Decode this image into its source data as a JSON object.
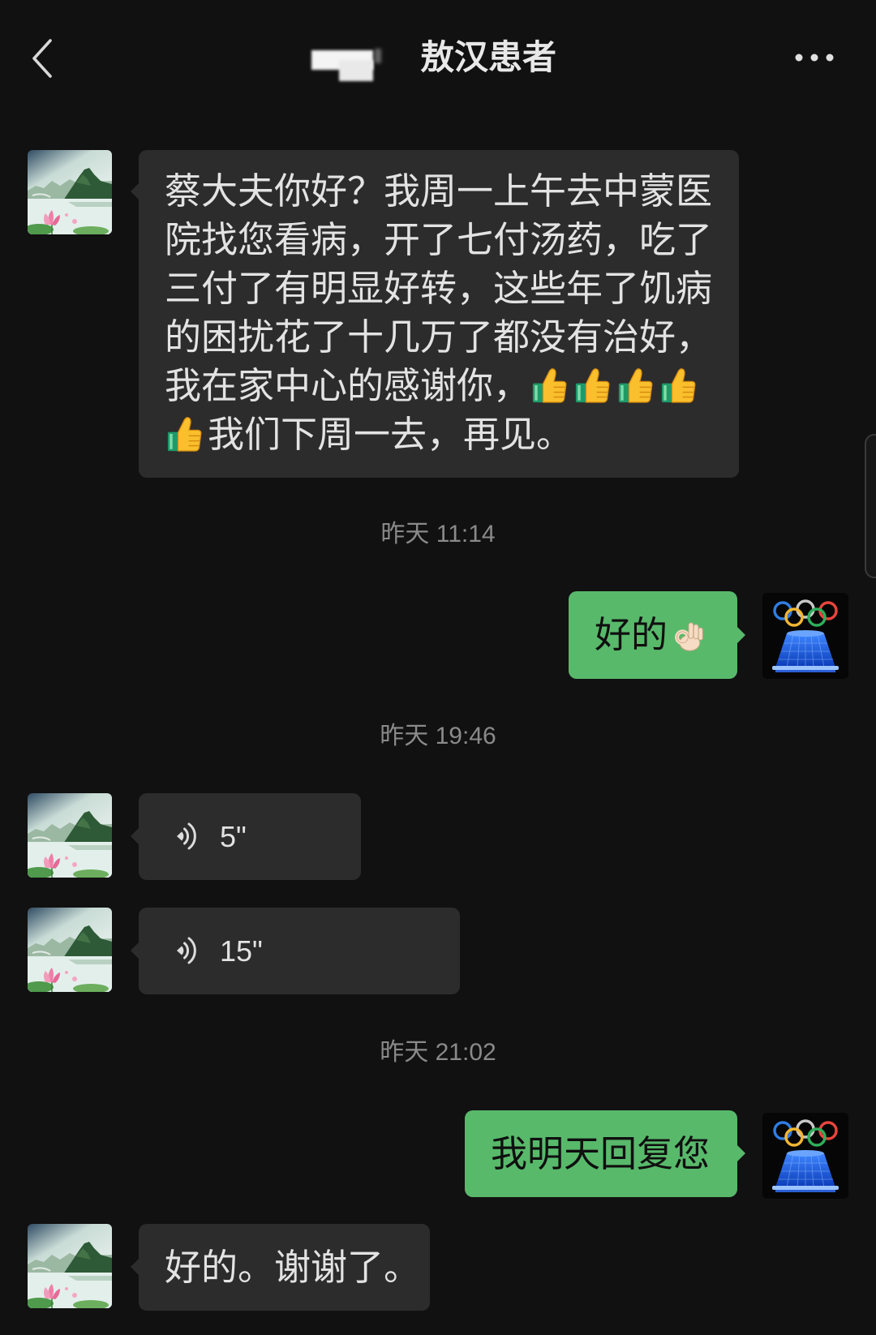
{
  "header": {
    "title": "敖汉患者",
    "back_icon": "chevron-left-icon",
    "more_icon": "more-dots-icon"
  },
  "colors": {
    "background": "#111111",
    "incoming_bubble": "#2c2c2c",
    "outgoing_bubble": "#58b96b",
    "timestamp_text": "#8a8a8a"
  },
  "messages": [
    {
      "incoming": {
        "lines": [
          "蔡大夫你好？我周一上午去中蒙医",
          "院找您看病，开了七付汤药，吃了",
          "三付了有明显好转，这些年了饥病",
          "的困扰花了十几万了都没有治好，",
          "我在家中心的感谢你，",
          "我们下周一去，再见。"
        ],
        "emoji_icon": "thumbs-up-icon",
        "emoji_count": 5
      }
    },
    {
      "timestamp": "昨天 11:14"
    },
    {
      "outgoing": {
        "text": "好的",
        "emoji_icon": "ok-hand-icon"
      }
    },
    {
      "timestamp": "昨天 19:46"
    },
    {
      "incoming_voice": {
        "duration": "5\"",
        "icon": "voice-wave-icon"
      }
    },
    {
      "incoming_voice": {
        "duration": "15\"",
        "icon": "voice-wave-icon"
      }
    },
    {
      "timestamp": "昨天 21:02"
    },
    {
      "outgoing": {
        "text": "我明天回复您"
      }
    },
    {
      "incoming": {
        "text": "好的。谢谢了。"
      }
    }
  ]
}
